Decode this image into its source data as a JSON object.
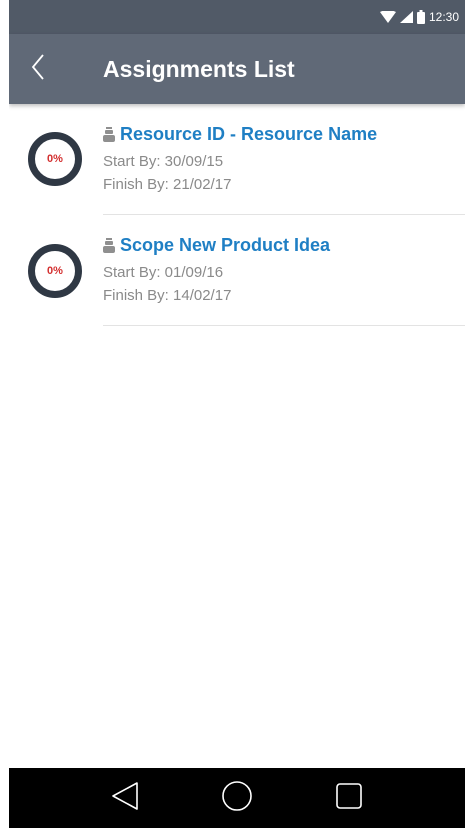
{
  "status_bar": {
    "time": "12:30"
  },
  "app_bar": {
    "title": "Assignments List"
  },
  "assignments": [
    {
      "title": "Resource ID - Resource Name",
      "progress_percent": 0,
      "progress_label": "0%",
      "start": "Start By: 30/09/15",
      "finish": "Finish By: 21/02/17"
    },
    {
      "title": "Scope New Product Idea",
      "progress_percent": 0,
      "progress_label": "0%",
      "start": "Start By: 01/09/16",
      "finish": "Finish By: 14/02/17"
    }
  ],
  "colors": {
    "app_bar": "#606977",
    "status_bar": "#515a67",
    "title_link": "#1f7fc4",
    "ring": "#2f3844",
    "percent_text": "#d32f2f"
  }
}
